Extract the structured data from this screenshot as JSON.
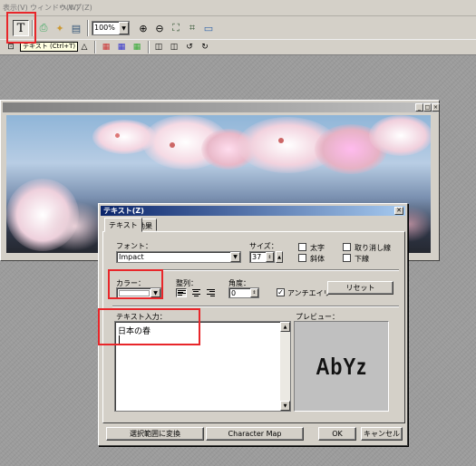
{
  "menubar": {
    "items": [
      "表示(V)",
      "ウィンドウ(W)",
      "ヘルプ(Z)"
    ]
  },
  "toolbar": {
    "zoom_value": "100%",
    "text_tool_label": "T",
    "text_tool_tooltip": "テキスト (Ctrl+T)"
  },
  "dialog": {
    "title": "テキスト(Z)",
    "close_label": "✕",
    "tabs": [
      "テキスト",
      "効果"
    ],
    "font_label": "フォント：",
    "font_value": "Impact",
    "size_label": "サイズ：",
    "size_value": "37",
    "bold_label": "太字",
    "italic_label": "斜体",
    "strike_label": "取り消し線",
    "underline_label": "下線",
    "color_label": "カラー：",
    "align_label": "整列：",
    "angle_label": "角度：",
    "angle_value": "0",
    "antialias_label": "アンチエイリ",
    "antialias_checked": "✓",
    "reset_button": "リセット",
    "text_input_label": "テキスト入力：",
    "text_input_value": "日本の春",
    "preview_label": "プレビュー：",
    "preview_text": "AbYz",
    "convert_button": "選択範囲に変換",
    "charmap_button": "Character Map",
    "ok_button": "OK",
    "cancel_button": "キャンセル"
  }
}
